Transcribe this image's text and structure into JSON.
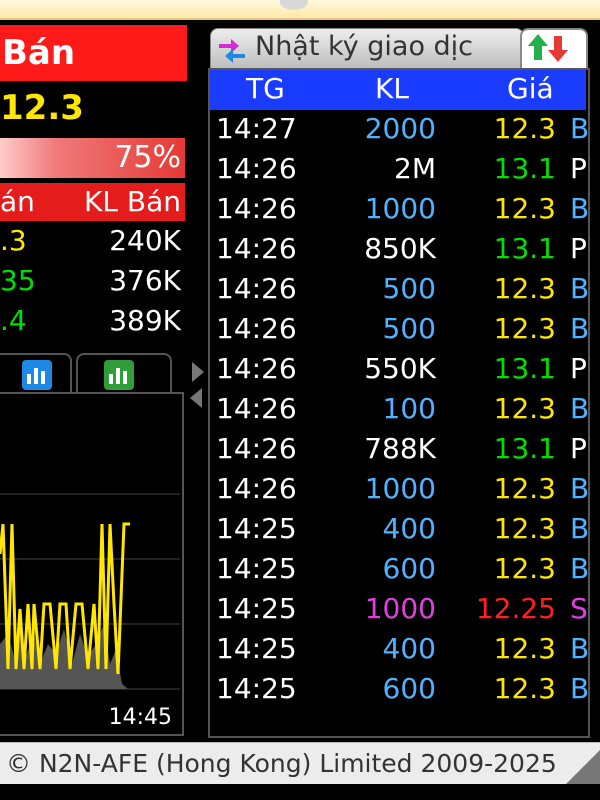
{
  "left": {
    "sell_header": "Bán",
    "price": "12.3",
    "ratio": "75%",
    "kl_header": {
      "c1": "án",
      "c2": "KL Bán"
    },
    "asks": [
      {
        "price": ".3",
        "volume": "240K",
        "color": "#ffe600"
      },
      {
        "price": "35",
        "volume": "376K",
        "color": "#00e000"
      },
      {
        "price": ".4",
        "volume": "389K",
        "color": "#00e000"
      }
    ],
    "chart_time": "14:45"
  },
  "journal": {
    "title": "Nhật ký giao dịc",
    "headers": {
      "tg": "TG",
      "kl": "KL",
      "gia": "Giá"
    },
    "rows": [
      {
        "time": "14:27",
        "kl": "2000",
        "kl_color": "#4fb3ff",
        "price": "12.3",
        "price_color": "#ffe600",
        "side": "B",
        "side_color": "#4fb3ff"
      },
      {
        "time": "14:26",
        "kl": "2M",
        "kl_color": "#ffffff",
        "price": "13.1",
        "price_color": "#00e000",
        "side": "P",
        "side_color": "#ffffff"
      },
      {
        "time": "14:26",
        "kl": "1000",
        "kl_color": "#4fb3ff",
        "price": "12.3",
        "price_color": "#ffe600",
        "side": "B",
        "side_color": "#4fb3ff"
      },
      {
        "time": "14:26",
        "kl": "850K",
        "kl_color": "#ffffff",
        "price": "13.1",
        "price_color": "#00e000",
        "side": "P",
        "side_color": "#ffffff"
      },
      {
        "time": "14:26",
        "kl": "500",
        "kl_color": "#4fb3ff",
        "price": "12.3",
        "price_color": "#ffe600",
        "side": "B",
        "side_color": "#4fb3ff"
      },
      {
        "time": "14:26",
        "kl": "500",
        "kl_color": "#4fb3ff",
        "price": "12.3",
        "price_color": "#ffe600",
        "side": "B",
        "side_color": "#4fb3ff"
      },
      {
        "time": "14:26",
        "kl": "550K",
        "kl_color": "#ffffff",
        "price": "13.1",
        "price_color": "#00e000",
        "side": "P",
        "side_color": "#ffffff"
      },
      {
        "time": "14:26",
        "kl": "100",
        "kl_color": "#4fb3ff",
        "price": "12.3",
        "price_color": "#ffe600",
        "side": "B",
        "side_color": "#4fb3ff"
      },
      {
        "time": "14:26",
        "kl": "788K",
        "kl_color": "#ffffff",
        "price": "13.1",
        "price_color": "#00e000",
        "side": "P",
        "side_color": "#ffffff"
      },
      {
        "time": "14:26",
        "kl": "1000",
        "kl_color": "#4fb3ff",
        "price": "12.3",
        "price_color": "#ffe600",
        "side": "B",
        "side_color": "#4fb3ff"
      },
      {
        "time": "14:25",
        "kl": "400",
        "kl_color": "#4fb3ff",
        "price": "12.3",
        "price_color": "#ffe600",
        "side": "B",
        "side_color": "#4fb3ff"
      },
      {
        "time": "14:25",
        "kl": "600",
        "kl_color": "#4fb3ff",
        "price": "12.3",
        "price_color": "#ffe600",
        "side": "B",
        "side_color": "#4fb3ff"
      },
      {
        "time": "14:25",
        "kl": "1000",
        "kl_color": "#e040e0",
        "price": "12.25",
        "price_color": "#ff2020",
        "side": "S",
        "side_color": "#e040e0"
      },
      {
        "time": "14:25",
        "kl": "400",
        "kl_color": "#4fb3ff",
        "price": "12.3",
        "price_color": "#ffe600",
        "side": "B",
        "side_color": "#4fb3ff"
      },
      {
        "time": "14:25",
        "kl": "600",
        "kl_color": "#4fb3ff",
        "price": "12.3",
        "price_color": "#ffe600",
        "side": "B",
        "side_color": "#4fb3ff"
      }
    ]
  },
  "footer": {
    "text": "© N2N-AFE (Hong Kong) Limited 2009-2025"
  }
}
